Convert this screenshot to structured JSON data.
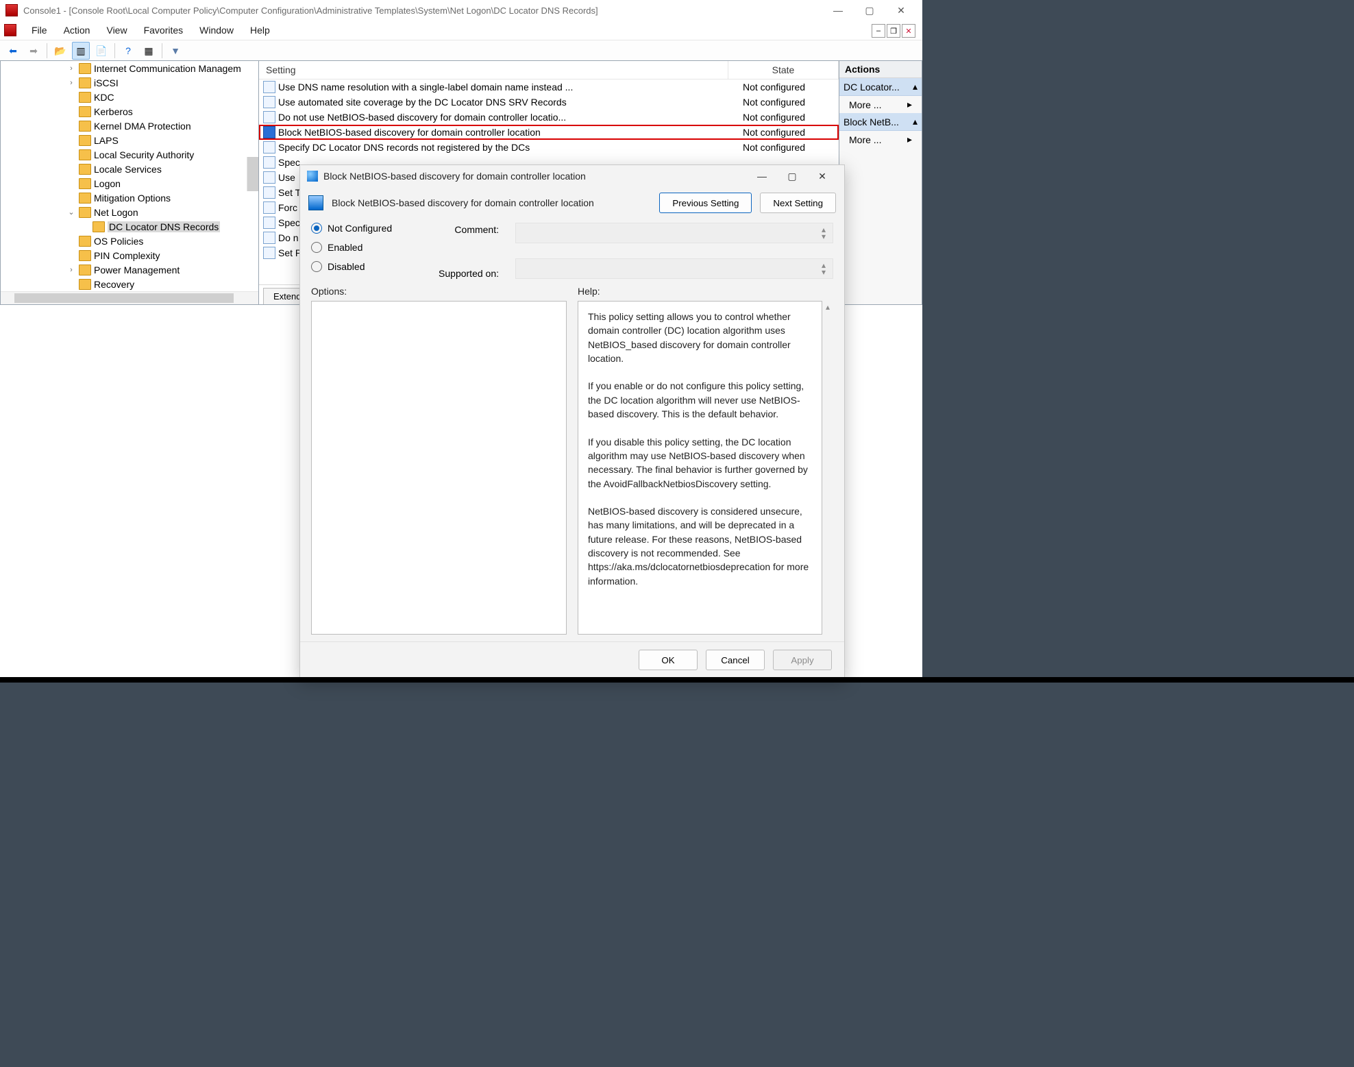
{
  "window": {
    "title": "Console1 - [Console Root\\Local Computer Policy\\Computer Configuration\\Administrative Templates\\System\\Net Logon\\DC Locator DNS Records]"
  },
  "menu": {
    "file": "File",
    "action": "Action",
    "view": "View",
    "favorites": "Favorites",
    "window": "Window",
    "help": "Help"
  },
  "tree": {
    "items": [
      {
        "indent": 96,
        "exp": "›",
        "label": "Internet Communication Managem"
      },
      {
        "indent": 96,
        "exp": "›",
        "label": "iSCSI"
      },
      {
        "indent": 96,
        "exp": "",
        "label": "KDC"
      },
      {
        "indent": 96,
        "exp": "",
        "label": "Kerberos"
      },
      {
        "indent": 96,
        "exp": "",
        "label": "Kernel DMA Protection"
      },
      {
        "indent": 96,
        "exp": "",
        "label": "LAPS"
      },
      {
        "indent": 96,
        "exp": "",
        "label": "Local Security Authority"
      },
      {
        "indent": 96,
        "exp": "",
        "label": "Locale Services"
      },
      {
        "indent": 96,
        "exp": "",
        "label": "Logon"
      },
      {
        "indent": 96,
        "exp": "",
        "label": "Mitigation Options"
      },
      {
        "indent": 96,
        "exp": "⌄",
        "label": "Net Logon"
      },
      {
        "indent": 116,
        "exp": "",
        "label": "DC Locator DNS Records",
        "selected": true
      },
      {
        "indent": 96,
        "exp": "",
        "label": "OS Policies"
      },
      {
        "indent": 96,
        "exp": "",
        "label": "PIN Complexity"
      },
      {
        "indent": 96,
        "exp": "›",
        "label": "Power Management"
      },
      {
        "indent": 96,
        "exp": "",
        "label": "Recovery"
      }
    ]
  },
  "list": {
    "col_setting": "Setting",
    "col_state": "State",
    "rows": [
      {
        "t": "Use DNS name resolution with a single-label domain name instead ...",
        "s": "Not configured"
      },
      {
        "t": "Use automated site coverage by the DC Locator DNS SRV Records",
        "s": "Not configured"
      },
      {
        "t": "Do not use NetBIOS-based discovery for domain controller locatio...",
        "s": "Not configured"
      },
      {
        "t": "Block NetBIOS-based discovery for domain controller location",
        "s": "Not configured",
        "hl": true
      },
      {
        "t": "Specify DC Locator DNS records not registered by the DCs",
        "s": "Not configured"
      },
      {
        "t": "Spec",
        "s": ""
      },
      {
        "t": "Use",
        "s": ""
      },
      {
        "t": "Set T",
        "s": ""
      },
      {
        "t": "Forc",
        "s": ""
      },
      {
        "t": "Spec",
        "s": ""
      },
      {
        "t": "Do n",
        "s": ""
      },
      {
        "t": "Set P",
        "s": ""
      }
    ],
    "tab_extended": "Extended"
  },
  "actions": {
    "head": "Actions",
    "g1": "DC Locator...",
    "more": "More ...",
    "g2": "Block NetB..."
  },
  "dialog": {
    "title": "Block NetBIOS-based discovery for domain controller location",
    "subtitle": "Block NetBIOS-based discovery for domain controller location",
    "prev": "Previous Setting",
    "next": "Next Setting",
    "notcfg": "Not Configured",
    "enabled": "Enabled",
    "disabled": "Disabled",
    "comment": "Comment:",
    "supported": "Supported on:",
    "options": "Options:",
    "help": "Help:",
    "help_text": "This policy setting allows you to control whether domain controller (DC) location algorithm uses NetBIOS_based discovery for domain controller location.\n\nIf you enable or do not configure this policy setting, the DC location algorithm will never use NetBIOS-based discovery. This is the default behavior.\n\nIf you disable this policy setting, the DC location algorithm may use NetBIOS-based discovery when necessary. The final behavior is further governed by the AvoidFallbackNetbiosDiscovery setting.\n\nNetBIOS-based discovery is considered unsecure, has many limitations, and will be deprecated in a future release. For these reasons, NetBIOS-based discovery is not recommended. See https://aka.ms/dclocatornetbiosdeprecation for more information.",
    "ok": "OK",
    "cancel": "Cancel",
    "apply": "Apply"
  }
}
